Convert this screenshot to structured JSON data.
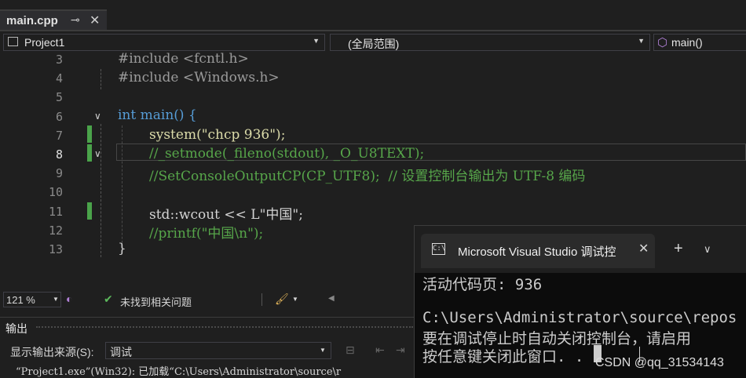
{
  "tab": {
    "name": "main.cpp",
    "pin_icon": "pin-icon",
    "close_icon": "close-icon"
  },
  "navbar": {
    "project": "Project1",
    "scope": "(全局范围)",
    "function": "main()"
  },
  "editor": {
    "lines": [
      {
        "num": "3",
        "text": "#include <fcntl.h>"
      },
      {
        "num": "4",
        "text": "#include <Windows.h>"
      },
      {
        "num": "5",
        "text": ""
      },
      {
        "num": "6",
        "text": "int main() {"
      },
      {
        "num": "7",
        "text": "system(\"chcp 936\");"
      },
      {
        "num": "8",
        "text": "//_setmode(_fileno(stdout), _O_U8TEXT);"
      },
      {
        "num": "9",
        "text": "//SetConsoleOutputCP(CP_UTF8);  // 设置控制台输出为 UTF-8 编码"
      },
      {
        "num": "10",
        "text": ""
      },
      {
        "num": "11",
        "text": "std::wcout << L\"中国\";"
      },
      {
        "num": "12",
        "text": "//printf(\"中国\\n\");"
      },
      {
        "num": "13",
        "text": "}"
      }
    ]
  },
  "status": {
    "zoom": "121 %",
    "issues": "未找到相关问题"
  },
  "output": {
    "title": "输出",
    "source_label": "显示输出来源(S):",
    "source_value": "调试",
    "log_line": "“Project1.exe”(Win32): 已加载“C:\\Users\\Administrator\\source\\r"
  },
  "console": {
    "title": "Microsoft Visual Studio 调试控",
    "line1": "活动代码页: 936",
    "line2": "C:\\Users\\Administrator\\source\\repos",
    "line3": "要在调试停止时自动关闭控制台，请启用",
    "line4": "按任意键关闭此窗口. . ."
  },
  "watermark": "CSDN @qq_31534143",
  "colors": {
    "keyword": "#569cd6",
    "function": "#dcdcaa",
    "string": "#d69d85",
    "comment": "#57a64a",
    "changebar": "#4aa34a"
  }
}
